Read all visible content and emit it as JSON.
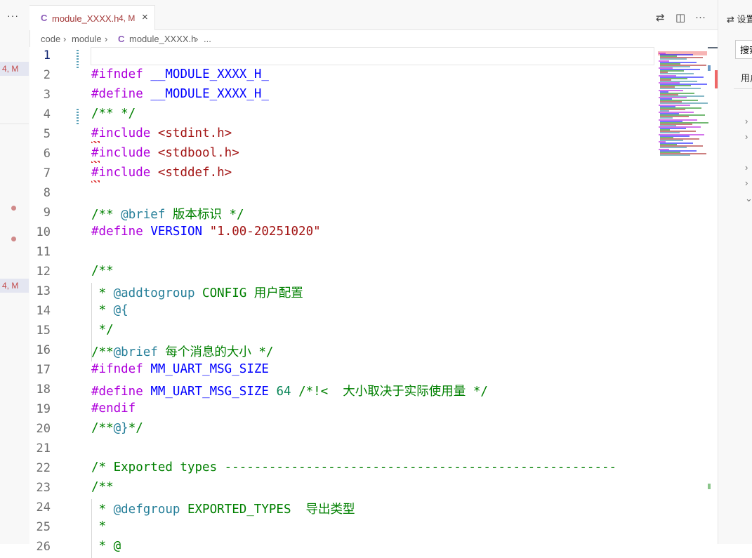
{
  "left_panel": {
    "more_label": "···",
    "badges": [
      "4, M",
      "4, M"
    ]
  },
  "tab": {
    "icon": "C",
    "filename": "module_XXXX.h",
    "status": "4, M",
    "close": "×"
  },
  "editor_actions": {
    "compare_icon": "⇄",
    "split_icon": "◫",
    "more_icon": "···"
  },
  "breadcrumb": {
    "items": [
      "code",
      "module",
      "module_XXXX.h",
      "..."
    ],
    "separator": "›",
    "file_icon": "C"
  },
  "code_lines": [
    {
      "n": "1",
      "segs": []
    },
    {
      "n": "2",
      "segs": [
        [
          "kw",
          "#ifndef"
        ],
        [
          "",
          " "
        ],
        [
          "mac",
          "__MODULE_XXXX_H_"
        ]
      ]
    },
    {
      "n": "3",
      "segs": [
        [
          "kw",
          "#define"
        ],
        [
          "",
          " "
        ],
        [
          "mac",
          "__MODULE_XXXX_H_"
        ]
      ]
    },
    {
      "n": "4",
      "segs": [
        [
          "cm",
          "/** */"
        ]
      ]
    },
    {
      "n": "5",
      "segs": [
        [
          "kw",
          "#include"
        ],
        [
          "",
          " "
        ],
        [
          "hdr",
          "<stdint.h>"
        ]
      ]
    },
    {
      "n": "6",
      "segs": [
        [
          "kw",
          "#include"
        ],
        [
          "",
          " "
        ],
        [
          "hdr",
          "<stdbool.h>"
        ]
      ]
    },
    {
      "n": "7",
      "segs": [
        [
          "kw",
          "#include"
        ],
        [
          "",
          " "
        ],
        [
          "hdr",
          "<stddef.h>"
        ]
      ]
    },
    {
      "n": "8",
      "segs": []
    },
    {
      "n": "9",
      "segs": [
        [
          "cm",
          "/** "
        ],
        [
          "tag",
          "@brief"
        ],
        [
          "cm",
          " 版本标识 */"
        ]
      ]
    },
    {
      "n": "10",
      "segs": [
        [
          "kw",
          "#define"
        ],
        [
          "",
          " "
        ],
        [
          "def",
          "VERSION"
        ],
        [
          "",
          " "
        ],
        [
          "str",
          "\"1.00-20251020\""
        ]
      ]
    },
    {
      "n": "11",
      "segs": []
    },
    {
      "n": "12",
      "segs": [
        [
          "cm",
          "/**"
        ]
      ]
    },
    {
      "n": "13",
      "segs": [
        [
          "cm",
          " * "
        ],
        [
          "tag",
          "@addtogroup"
        ],
        [
          "cm",
          " CONFIG 用户配置"
        ]
      ]
    },
    {
      "n": "14",
      "segs": [
        [
          "cm",
          " * "
        ],
        [
          "tag",
          "@{"
        ]
      ]
    },
    {
      "n": "15",
      "segs": [
        [
          "cm",
          " */"
        ]
      ]
    },
    {
      "n": "16",
      "segs": [
        [
          "cm",
          "/**"
        ],
        [
          "tag",
          "@brief"
        ],
        [
          "cm",
          " 每个消息的大小 */"
        ]
      ]
    },
    {
      "n": "17",
      "segs": [
        [
          "kw",
          "#ifndef"
        ],
        [
          "",
          " "
        ],
        [
          "def",
          "MM_UART_MSG_SIZE"
        ]
      ]
    },
    {
      "n": "18",
      "segs": [
        [
          "kw",
          "#define"
        ],
        [
          "",
          " "
        ],
        [
          "def",
          "MM_UART_MSG_SIZE"
        ],
        [
          "",
          " "
        ],
        [
          "num",
          "64"
        ],
        [
          "",
          " "
        ],
        [
          "cm",
          "/*!<  大小取决于实际使用量 */"
        ]
      ]
    },
    {
      "n": "19",
      "segs": [
        [
          "kw",
          "#endif"
        ]
      ]
    },
    {
      "n": "20",
      "segs": [
        [
          "cm",
          "/**"
        ],
        [
          "tag",
          "@}"
        ],
        [
          "cm",
          "*/"
        ]
      ]
    },
    {
      "n": "21",
      "segs": []
    },
    {
      "n": "22",
      "segs": [
        [
          "cm",
          "/* Exported types -----------------------------------------------------"
        ]
      ]
    },
    {
      "n": "23",
      "segs": [
        [
          "cm",
          "/**"
        ]
      ]
    },
    {
      "n": "24",
      "segs": [
        [
          "cm",
          " * "
        ],
        [
          "tag",
          "@defgroup"
        ],
        [
          "cm",
          " EXPORTED_TYPES  导出类型"
        ]
      ]
    },
    {
      "n": "25",
      "segs": [
        [
          "cm",
          " *"
        ]
      ]
    },
    {
      "n": "26",
      "segs": [
        [
          "cm",
          " * @"
        ]
      ]
    }
  ],
  "right_panel": {
    "title": "⇄ 设置",
    "search_placeholder": "搜索",
    "tab_label": "用户"
  },
  "colors": {
    "keyword": "#af00db",
    "macro": "#0000ff",
    "comment": "#008000",
    "string": "#a31515",
    "number": "#098658",
    "doc_tag": "#267f99",
    "error_badge": "#c24a4a"
  }
}
